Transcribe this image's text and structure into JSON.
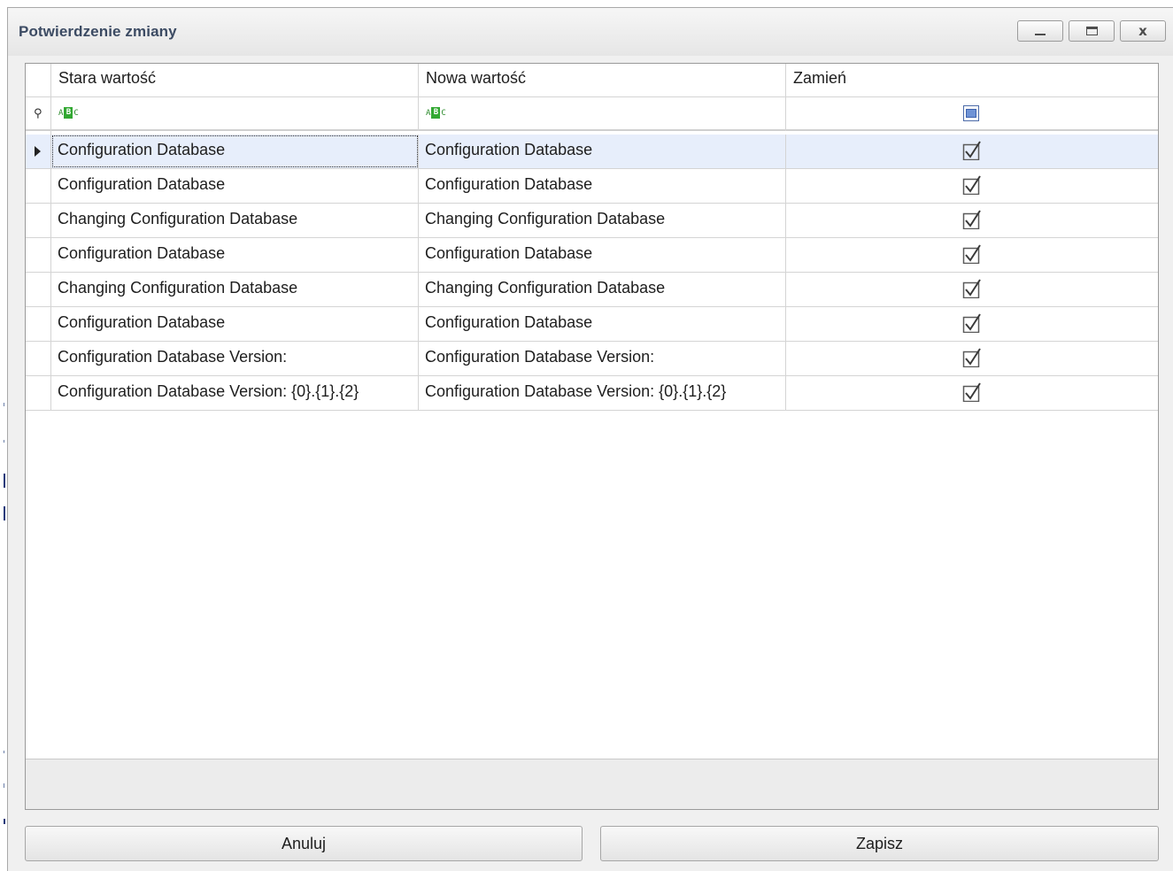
{
  "window": {
    "title": "Potwierdzenie zmiany",
    "close_glyph": "x"
  },
  "grid": {
    "columns": [
      {
        "label": "Stara wartość"
      },
      {
        "label": "Nowa wartość"
      },
      {
        "label": "Zamień"
      }
    ],
    "filter_row": {
      "text_filter_icon": "abc-filter-icon",
      "abc_letters": [
        "A",
        "B",
        "C"
      ]
    },
    "rows": [
      {
        "old": "Configuration Database",
        "new": "Configuration Database",
        "replace": true,
        "selected": true
      },
      {
        "old": "Configuration Database",
        "new": "Configuration Database",
        "replace": true
      },
      {
        "old": "Changing Configuration Database",
        "new": "Changing Configuration Database",
        "replace": true
      },
      {
        "old": "Configuration Database",
        "new": "Configuration Database",
        "replace": true
      },
      {
        "old": "Changing Configuration Database",
        "new": "Changing Configuration Database",
        "replace": true
      },
      {
        "old": "Configuration Database",
        "new": "Configuration Database",
        "replace": true
      },
      {
        "old": "Configuration Database Version:",
        "new": "Configuration Database Version:",
        "replace": true
      },
      {
        "old": "Configuration Database Version: {0}.{1}.{2}",
        "new": "Configuration Database Version: {0}.{1}.{2}",
        "replace": true
      }
    ]
  },
  "buttons": {
    "cancel_label": "Anuluj",
    "save_label": "Zapisz"
  },
  "colors": {
    "selected_row": "#e7eefb",
    "title_text": "#3c4b63",
    "filter_icon_green": "#32a832"
  }
}
